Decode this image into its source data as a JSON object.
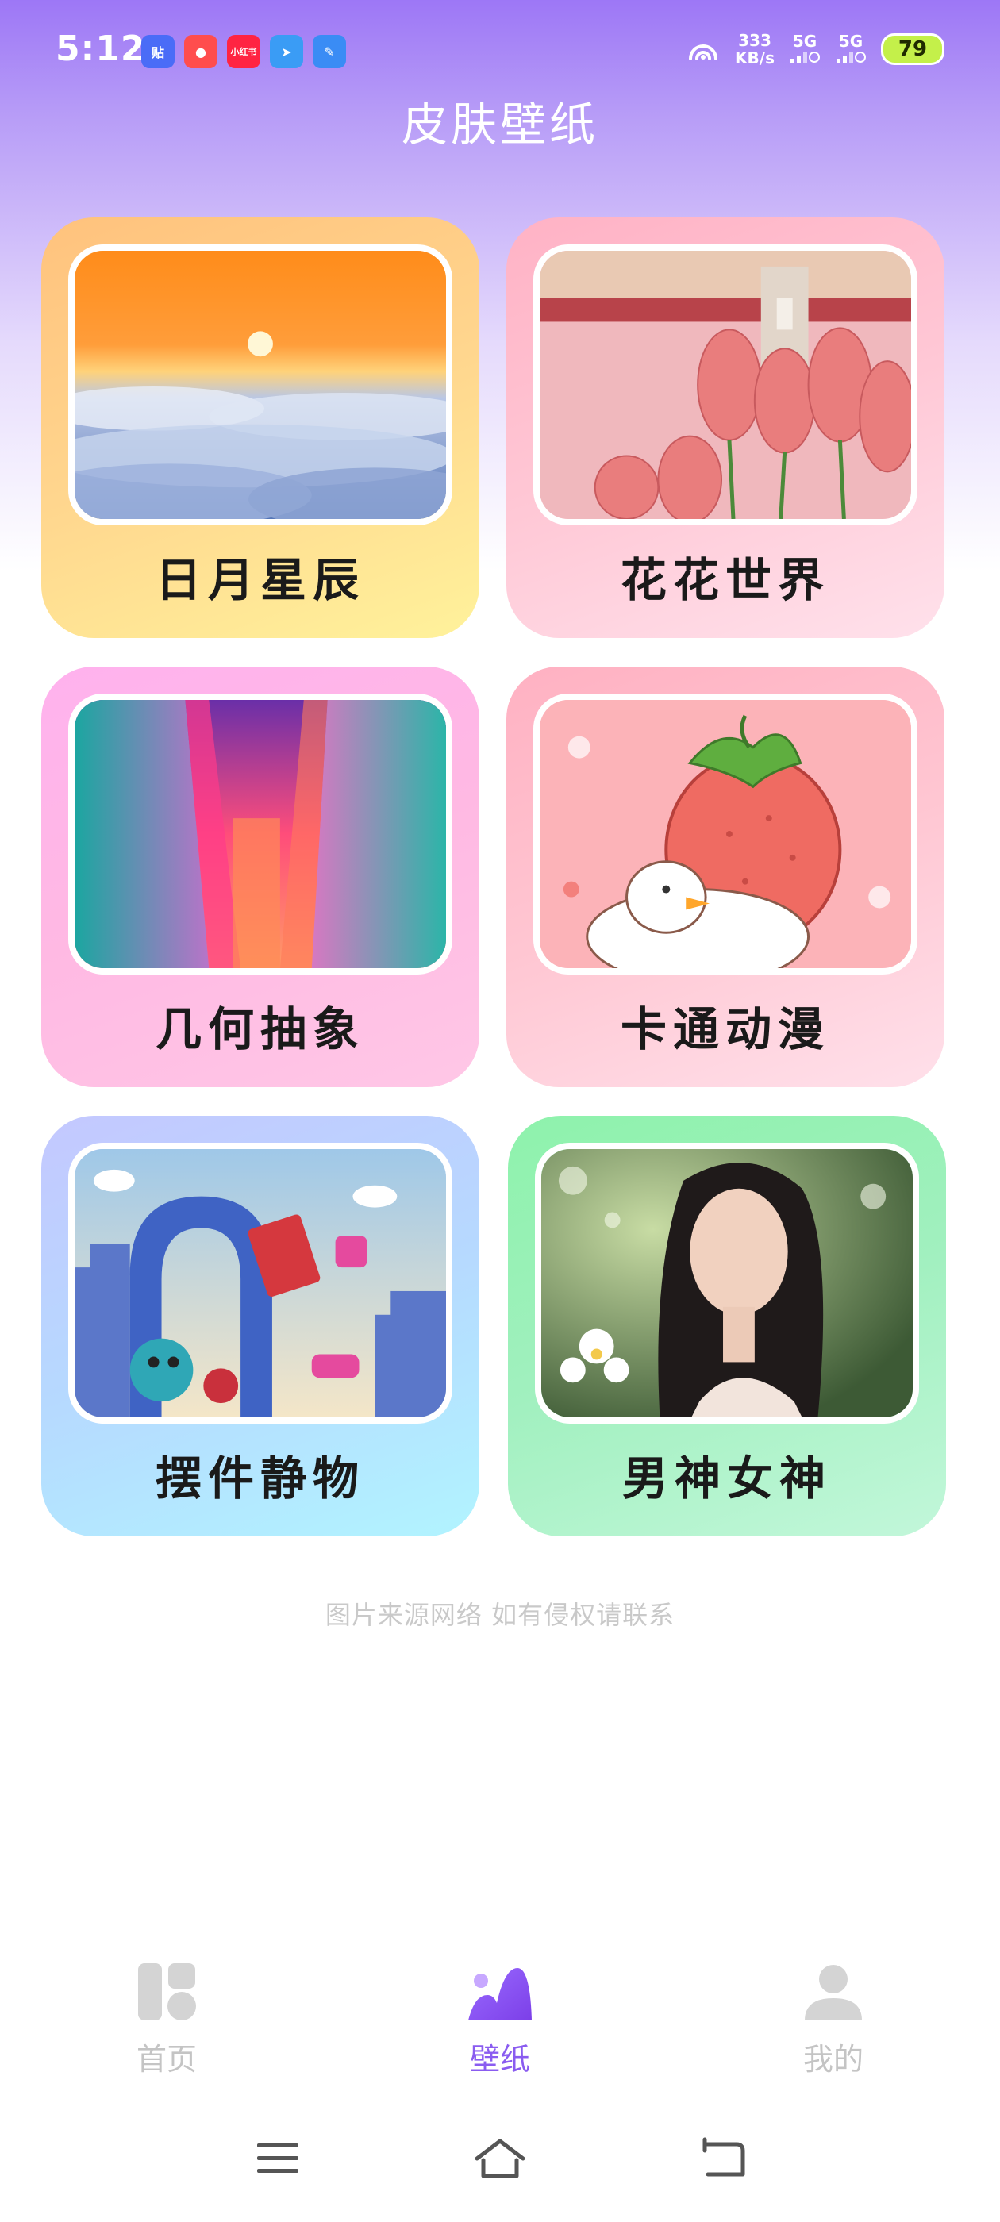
{
  "status": {
    "time": "5:12",
    "apps": [
      {
        "name": "tieba-icon",
        "text": "贴",
        "color": "#4a6cf7"
      },
      {
        "name": "mascot-app-icon",
        "text": "●",
        "color": "#ff4d4d"
      },
      {
        "name": "xiaohongshu-icon",
        "text": "小红书",
        "color": "#ff2442"
      },
      {
        "name": "paper-plane-app-icon",
        "text": "➤",
        "color": "#3a9cf5"
      },
      {
        "name": "pen-app-icon",
        "text": "✎",
        "color": "#3a8cf5"
      }
    ],
    "speed_value": "333",
    "speed_unit": "KB/s",
    "sim1": "5G",
    "sim2": "5G",
    "battery": "79"
  },
  "header": {
    "title": "皮肤壁纸"
  },
  "categories": [
    {
      "label": "日月星辰",
      "image": "sunrise-over-clouds"
    },
    {
      "label": "花花世界",
      "image": "pink-tulip-field"
    },
    {
      "label": "几何抽象",
      "image": "neon-corridor"
    },
    {
      "label": "卡通动漫",
      "image": "cartoon-strawberry-duck"
    },
    {
      "label": "摆件静物",
      "image": "3d-arch-still-life"
    },
    {
      "label": "男神女神",
      "image": "portrait-woman-flowers"
    }
  ],
  "footer_note": "图片来源网络  如有侵权请联系",
  "tabbar": {
    "items": [
      {
        "label": "首页",
        "icon": "home-grid-icon",
        "active": false
      },
      {
        "label": "壁纸",
        "icon": "wallpaper-mountain-icon",
        "active": true
      },
      {
        "label": "我的",
        "icon": "person-icon",
        "active": false
      }
    ]
  },
  "colors": {
    "accent": "#8a5cf0",
    "inactive": "#c4c4c4"
  }
}
